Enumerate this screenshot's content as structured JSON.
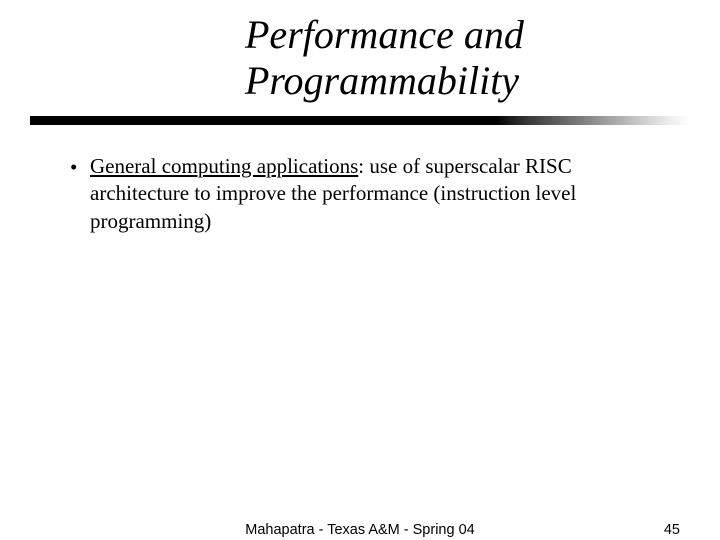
{
  "title": {
    "line1": "Performance and",
    "line2": "Programmability"
  },
  "bullets": [
    {
      "lead": "General computing applications",
      "rest": ": use of superscalar RISC architecture to improve the performance (instruction level programming)"
    }
  ],
  "footer": {
    "credit": "Mahapatra - Texas A&M - Spring 04",
    "page": "45"
  }
}
